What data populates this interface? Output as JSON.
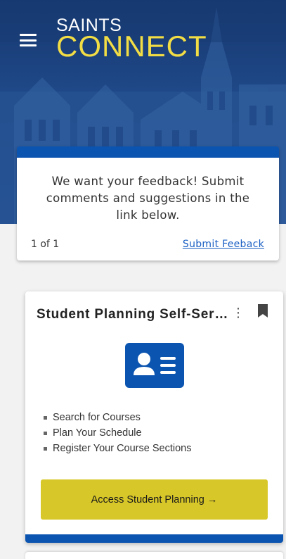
{
  "header": {
    "logo_top": "SAINTS",
    "logo_bottom": "CONNECT",
    "colors": {
      "hero": "#1f4a8a",
      "logo_accent": "#f2dd45"
    }
  },
  "feedback": {
    "message": "We want your feedback! Submit comments and suggestions in the link below.",
    "count": "1 of 1",
    "link_label": "Submit Feeback",
    "accent": "#0b54b0"
  },
  "plan_card": {
    "title": "Student Planning Self-Servi…",
    "icon": "contact-card-icon",
    "features": [
      "Search for Courses",
      "Plan Your Schedule",
      "Register Your Course Sections"
    ],
    "button_label": "Access Student Planning →",
    "button_color": "#d7c728"
  }
}
